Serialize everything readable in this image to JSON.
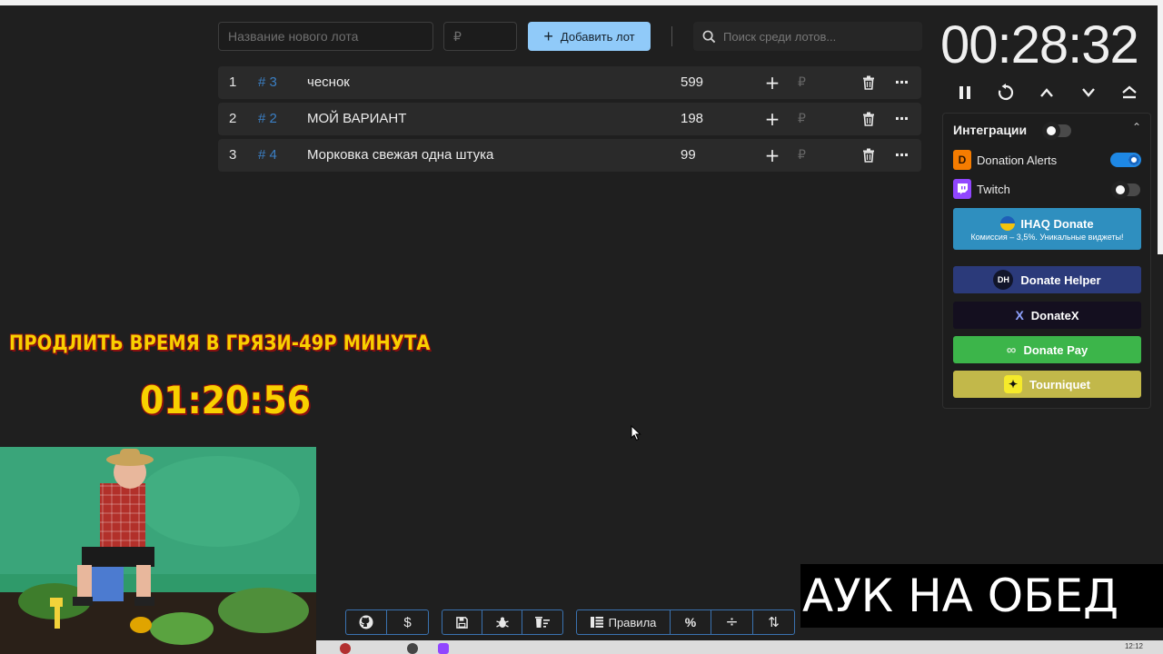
{
  "top_bar": {
    "lot_name_placeholder": "Название нового лота",
    "price_placeholder": "₽",
    "add_button_label": "Добавить лот",
    "search_placeholder": "Поиск среди лотов..."
  },
  "lots": [
    {
      "index": "1",
      "hash": "# 3",
      "name": "чеснок",
      "amount": "599",
      "currency": "₽"
    },
    {
      "index": "2",
      "hash": "# 2",
      "name": "МОЙ ВАРИАНТ",
      "amount": "198",
      "currency": "₽"
    },
    {
      "index": "3",
      "hash": "# 4",
      "name": "Морковка свежая одна штука",
      "amount": "99",
      "currency": "₽"
    }
  ],
  "timer": {
    "value": "00:28:32",
    "controls": [
      "pause-icon",
      "restart-icon",
      "chevron-up-icon",
      "chevron-down-icon",
      "eject-icon"
    ]
  },
  "integrations": {
    "title": "Интеграции",
    "enabled": false,
    "services": [
      {
        "name": "Donation Alerts",
        "enabled": true,
        "icon": "donation-alerts-icon",
        "color": "#f57c00"
      },
      {
        "name": "Twitch",
        "enabled": false,
        "icon": "twitch-icon",
        "color": "#9146ff"
      }
    ],
    "promos": [
      {
        "title": "IHAQ Donate",
        "subtitle": "Комиссия – 3,5%. Уникальные виджеты!",
        "color": "#2f8fbf"
      },
      {
        "title": "Donate Helper",
        "badge": "DH",
        "color": "#2b3a7a"
      },
      {
        "title": "DonateX",
        "badge": "X",
        "color": "#140f1f"
      },
      {
        "title": "Donate Pay",
        "badge": "∞",
        "color": "#3cb54a"
      },
      {
        "title": "Tourniquet",
        "badge": "✦",
        "color": "#c2b84a"
      }
    ]
  },
  "overlay": {
    "banner": "ПРОДЛИТЬ ВРЕМЯ В ГРЯЗИ-49Р МИНУТА",
    "timer": "01:20:56",
    "caption": "АУК НА ОБЕД"
  },
  "toolbar": {
    "groups": [
      [
        {
          "icon": "github-icon"
        },
        {
          "icon": "dollar-icon",
          "glyph": "$"
        }
      ],
      [
        {
          "icon": "save-icon"
        },
        {
          "icon": "bug-icon"
        },
        {
          "icon": "clear-list-icon"
        }
      ],
      [
        {
          "icon": "rules-icon",
          "label": "Правила"
        },
        {
          "icon": "percent-icon",
          "glyph": "%"
        },
        {
          "icon": "split-icon",
          "glyph": "÷"
        },
        {
          "icon": "sort-icon",
          "glyph": "⇅"
        }
      ]
    ]
  },
  "taskbar": {
    "time": "12:12"
  }
}
